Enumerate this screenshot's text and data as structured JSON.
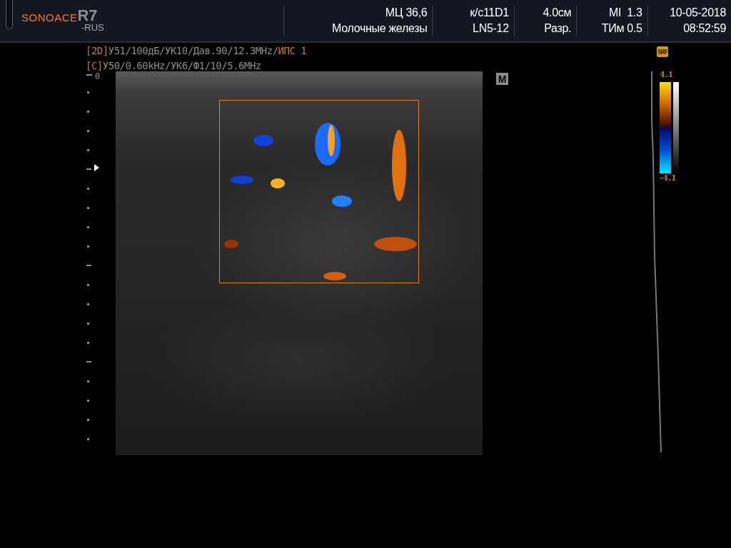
{
  "logo": {
    "brand": "SONOACE",
    "model": "R7",
    "region": "-RUS"
  },
  "header_cells": [
    {
      "line1": "МЦ 36,6",
      "line2": "Молочные железы"
    },
    {
      "line1": "к/с11D1",
      "line2": "LN5-12"
    },
    {
      "line1": "4.0см",
      "line2": "Разр."
    },
    {
      "line1": "MI  1.3",
      "line2": "ТИм 0.5"
    },
    {
      "line1": "10-05-2018",
      "line2": "08:52:59"
    }
  ],
  "params": [
    {
      "tag": "[2D]",
      "text": "У51/100дБ/УК10/Дав.90/12.3MHz/",
      "extra": "ИПС 1"
    },
    {
      "tag": "[C]",
      "text": "У50/0.60kHz/УК6/Ф1/10/5.6MHz"
    }
  ],
  "srf_badge": "SRF",
  "depth_scale": {
    "start": "0"
  },
  "mode_badge": "M",
  "color_scale": {
    "max": "4.1",
    "min": "-4.1"
  }
}
